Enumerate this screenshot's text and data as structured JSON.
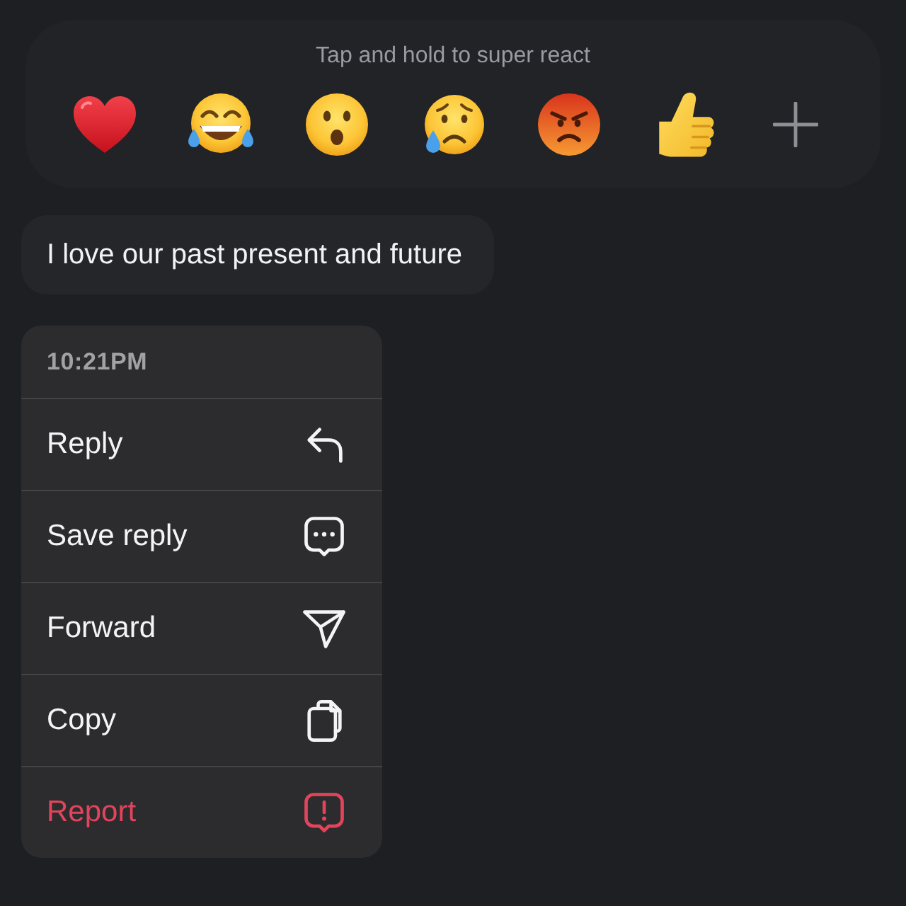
{
  "reaction_bar": {
    "hint": "Tap and hold to super react",
    "reactions": [
      {
        "kind": "heart"
      },
      {
        "kind": "laughing"
      },
      {
        "kind": "surprised"
      },
      {
        "kind": "crying"
      },
      {
        "kind": "angry"
      },
      {
        "kind": "thumbs_up"
      }
    ]
  },
  "message": {
    "text": "I love our past present and future"
  },
  "context_menu": {
    "time": "10:21PM",
    "items": [
      {
        "label": "Reply",
        "kind": "reply",
        "destructive": false
      },
      {
        "label": "Save reply",
        "kind": "save_reply",
        "destructive": false
      },
      {
        "label": "Forward",
        "kind": "forward",
        "destructive": false
      },
      {
        "label": "Copy",
        "kind": "copy",
        "destructive": false
      },
      {
        "label": "Report",
        "kind": "report",
        "destructive": true
      }
    ]
  }
}
